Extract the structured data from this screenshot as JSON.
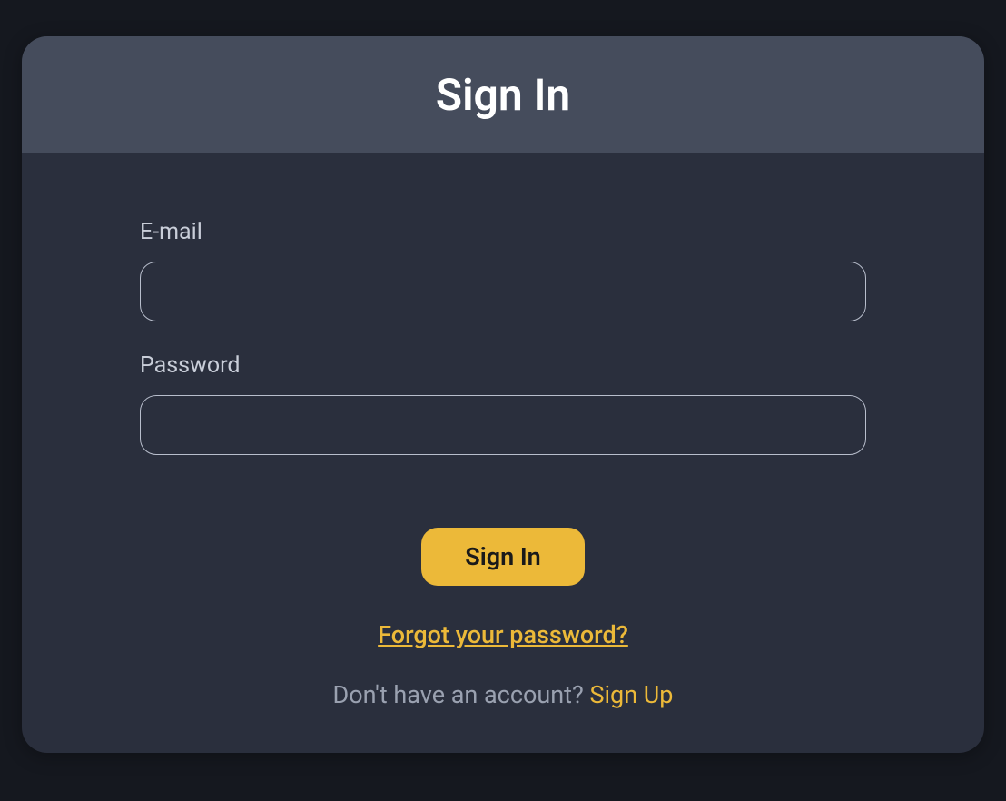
{
  "header": {
    "title": "Sign In"
  },
  "form": {
    "email": {
      "label": "E-mail",
      "value": ""
    },
    "password": {
      "label": "Password",
      "value": ""
    }
  },
  "actions": {
    "submit_label": "Sign In",
    "forgot_label": "Forgot your password?",
    "signup_prompt": "Don't have an account? ",
    "signup_link": "Sign Up"
  }
}
